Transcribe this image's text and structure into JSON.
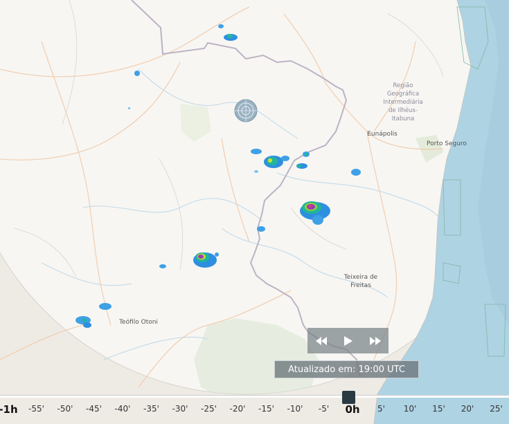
{
  "map": {
    "cities": [
      {
        "name": "Eunápolis"
      },
      {
        "name": "Porto Seguro"
      },
      {
        "name": "Teófilo Otoni"
      }
    ],
    "multiline_labels": [
      {
        "lines": [
          "Região",
          "Geográfica",
          "Intermediária",
          "de Ilhéus-",
          "Itabuna"
        ]
      },
      {
        "lines": [
          "Teixeira de",
          "Freitas"
        ]
      }
    ]
  },
  "controls": {
    "rewind_icon": "rewind-icon",
    "play_icon": "play-icon",
    "forward_icon": "fast-forward-icon"
  },
  "status": {
    "updated": "Atualizado em: 19:00 UTC"
  },
  "timeline": {
    "ticks": [
      "-1h",
      "-55'",
      "-50'",
      "-45'",
      "-40'",
      "-35'",
      "-30'",
      "-25'",
      "-20'",
      "-15'",
      "-10'",
      "-5'",
      "0h",
      "5'",
      "10'",
      "15'",
      "20'",
      "25'"
    ],
    "current": "0h"
  }
}
